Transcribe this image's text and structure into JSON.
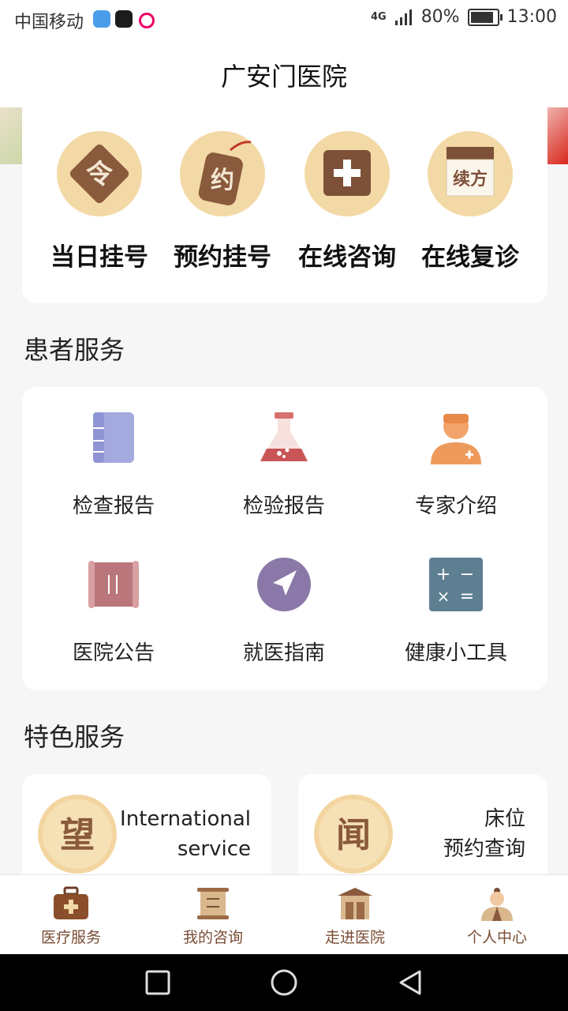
{
  "status_bar": {
    "carrier": "中国移动",
    "battery": "80%",
    "time": "13:00",
    "network": "4G"
  },
  "header": {
    "title": "广安门医院"
  },
  "quick_actions": [
    {
      "label": "当日挂号",
      "icon": "ling-icon"
    },
    {
      "label": "预约挂号",
      "icon": "yue-icon"
    },
    {
      "label": "在线咨询",
      "icon": "plus-board-icon"
    },
    {
      "label": "在线复诊",
      "icon": "xufang-icon"
    }
  ],
  "patient_services": {
    "title": "患者服务",
    "items": [
      {
        "label": "检查报告",
        "icon": "report-book-icon"
      },
      {
        "label": "检验报告",
        "icon": "flask-icon"
      },
      {
        "label": "专家介绍",
        "icon": "doctor-icon"
      },
      {
        "label": "医院公告",
        "icon": "scroll-icon"
      },
      {
        "label": "就医指南",
        "icon": "navigation-icon"
      },
      {
        "label": "健康小工具",
        "icon": "calculator-icon"
      }
    ]
  },
  "featured": {
    "title": "特色服务",
    "cards": [
      {
        "glyph": "望",
        "line1": "International",
        "line2": "service"
      },
      {
        "glyph": "闻",
        "line1": "床位",
        "line2": "预约查询"
      }
    ]
  },
  "tabs": [
    {
      "label": "医疗服务",
      "icon": "medical-kit-icon"
    },
    {
      "label": "我的咨询",
      "icon": "scroll-tab-icon"
    },
    {
      "label": "走进医院",
      "icon": "hospital-building-icon"
    },
    {
      "label": "个人中心",
      "icon": "person-icon"
    }
  ],
  "colors": {
    "accent": "#7a4d35",
    "badge": "#f3d9a6"
  }
}
